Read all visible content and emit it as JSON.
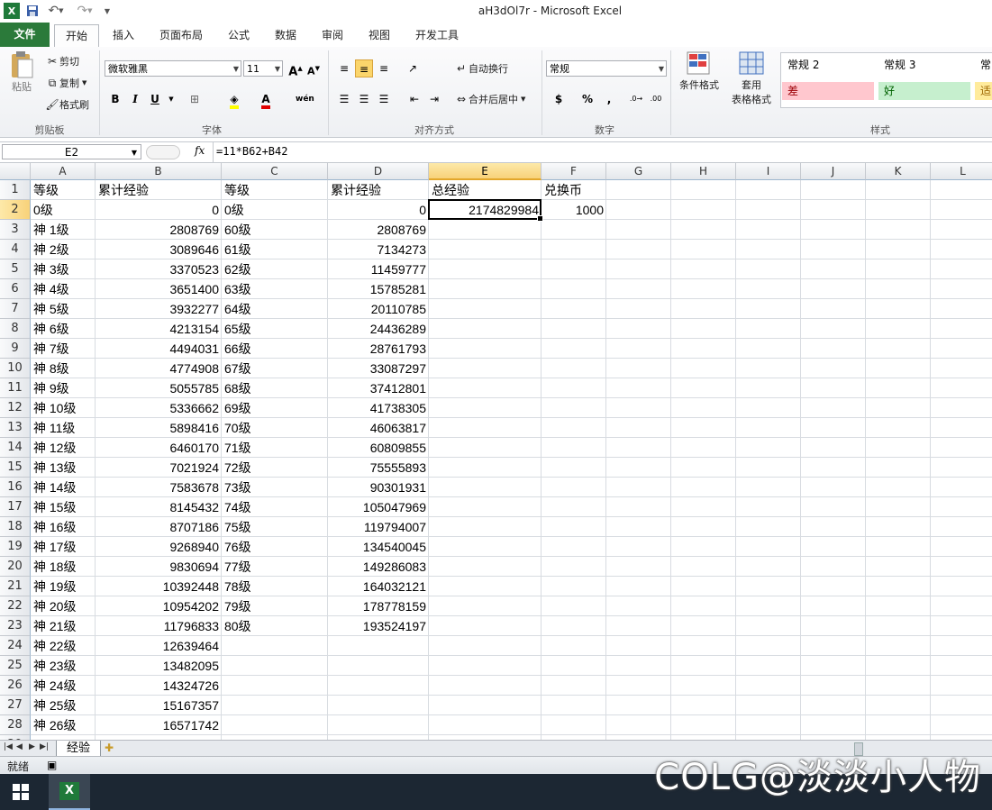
{
  "window": {
    "title": "aH3dOl7r  -  Microsoft Excel"
  },
  "ribbon_tabs": [
    "文件",
    "开始",
    "插入",
    "页面布局",
    "公式",
    "数据",
    "审阅",
    "视图",
    "开发工具"
  ],
  "clipboard": {
    "paste": "粘贴",
    "cut": "剪切",
    "copy": "复制",
    "format_painter": "格式刷",
    "group": "剪贴板"
  },
  "font": {
    "name": "微软雅黑",
    "size": "11",
    "group": "字体"
  },
  "alignment": {
    "wrap": "自动换行",
    "merge": "合并后居中",
    "group": "对齐方式"
  },
  "number": {
    "format": "常规",
    "group": "数字",
    "currency": "$",
    "percent": "%",
    "comma": ","
  },
  "styles": {
    "conditional": "条件格式",
    "table_format_1": "套用",
    "table_format_2": "表格格式",
    "normal2": "常规 2",
    "normal3": "常规 3",
    "normal_more": "常",
    "bad": "差",
    "good": "好",
    "neutral": "适",
    "group": "样式",
    "colors": {
      "bad": "#ffc7ce",
      "good": "#c6efce",
      "neutral": "#ffeb9c"
    }
  },
  "formula_bar": {
    "name_box": "E2",
    "fx": "fx",
    "formula": "=11*B62+B42"
  },
  "columns": [
    "A",
    "B",
    "C",
    "D",
    "E",
    "F",
    "G",
    "H",
    "I",
    "J",
    "K",
    "L"
  ],
  "rows": [
    [
      "等级",
      "累计经验",
      "等级",
      "累计经验",
      "总经验",
      "兑换币"
    ],
    [
      "0级",
      "0",
      "0级",
      "0",
      "2174829984",
      "1000"
    ],
    [
      "神 1级",
      "2808769",
      "60级",
      "2808769",
      "",
      ""
    ],
    [
      "神 2级",
      "3089646",
      "61级",
      "7134273",
      "",
      ""
    ],
    [
      "神 3级",
      "3370523",
      "62级",
      "11459777",
      "",
      ""
    ],
    [
      "神 4级",
      "3651400",
      "63级",
      "15785281",
      "",
      ""
    ],
    [
      "神 5级",
      "3932277",
      "64级",
      "20110785",
      "",
      ""
    ],
    [
      "神 6级",
      "4213154",
      "65级",
      "24436289",
      "",
      ""
    ],
    [
      "神 7级",
      "4494031",
      "66级",
      "28761793",
      "",
      ""
    ],
    [
      "神 8级",
      "4774908",
      "67级",
      "33087297",
      "",
      ""
    ],
    [
      "神 9级",
      "5055785",
      "68级",
      "37412801",
      "",
      ""
    ],
    [
      "神 10级",
      "5336662",
      "69级",
      "41738305",
      "",
      ""
    ],
    [
      "神 11级",
      "5898416",
      "70级",
      "46063817",
      "",
      ""
    ],
    [
      "神 12级",
      "6460170",
      "71级",
      "60809855",
      "",
      ""
    ],
    [
      "神 13级",
      "7021924",
      "72级",
      "75555893",
      "",
      ""
    ],
    [
      "神 14级",
      "7583678",
      "73级",
      "90301931",
      "",
      ""
    ],
    [
      "神 15级",
      "8145432",
      "74级",
      "105047969",
      "",
      ""
    ],
    [
      "神 16级",
      "8707186",
      "75级",
      "119794007",
      "",
      ""
    ],
    [
      "神 17级",
      "9268940",
      "76级",
      "134540045",
      "",
      ""
    ],
    [
      "神 18级",
      "9830694",
      "77级",
      "149286083",
      "",
      ""
    ],
    [
      "神 19级",
      "10392448",
      "78级",
      "164032121",
      "",
      ""
    ],
    [
      "神 20级",
      "10954202",
      "79级",
      "178778159",
      "",
      ""
    ],
    [
      "神 21级",
      "11796833",
      "80级",
      "193524197",
      "",
      ""
    ],
    [
      "神 22级",
      "12639464",
      "",
      "",
      "",
      ""
    ],
    [
      "神 23级",
      "13482095",
      "",
      "",
      "",
      ""
    ],
    [
      "神 24级",
      "14324726",
      "",
      "",
      "",
      ""
    ],
    [
      "神 25级",
      "15167357",
      "",
      "",
      "",
      ""
    ],
    [
      "神 26级",
      "16571742",
      "",
      "",
      "",
      ""
    ]
  ],
  "sheet_tab": "经验",
  "status": "就绪",
  "watermark": "COLG@淡淡小人物"
}
